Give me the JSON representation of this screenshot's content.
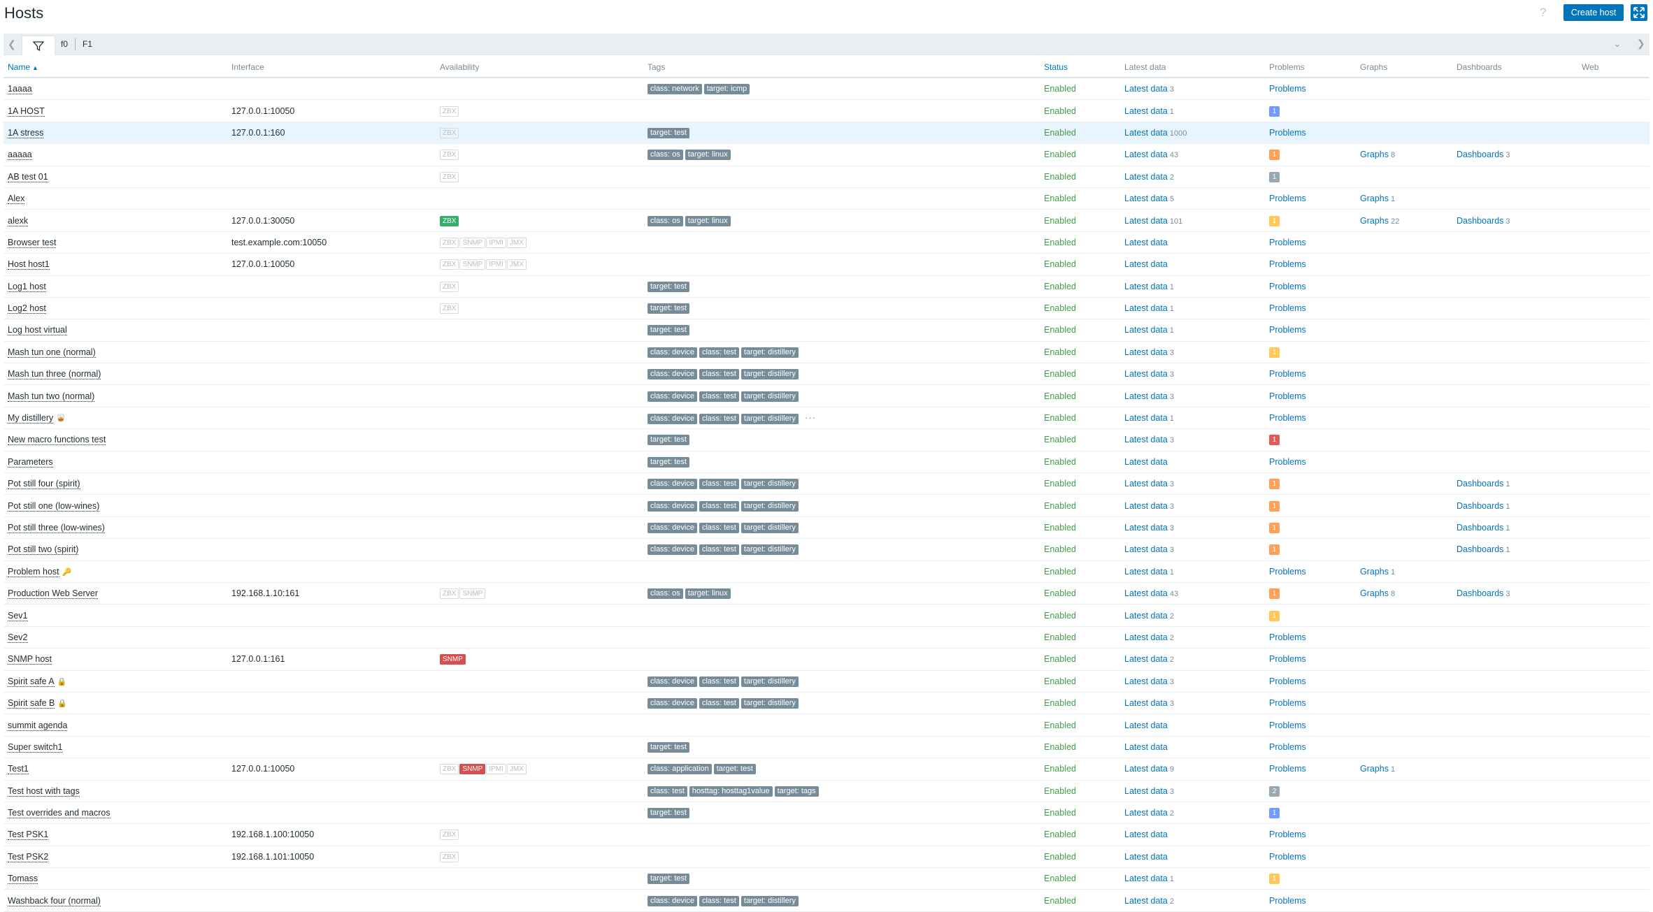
{
  "header": {
    "title": "Hosts",
    "help_glyph": "?",
    "create_label": "Create host",
    "fullscreen_icon": "fullscreen-icon"
  },
  "filter_tabs": [
    "f0",
    "F1"
  ],
  "columns": [
    "Name",
    "Interface",
    "Availability",
    "Tags",
    "Status",
    "Latest data",
    "Problems",
    "Graphs",
    "Dashboards",
    "Web"
  ],
  "colors": {
    "accent": "#0275b8",
    "enabled": "#429e47",
    "tag": "#768d99",
    "sev_info": "#7499ff",
    "sev_warning": "#ffa059",
    "sev_average": "#ffc859",
    "sev_high": "#e45959",
    "sev_unclassified": "#97aab3",
    "zbx_ok": "#34af67",
    "snmp_error": "#d64e4e"
  },
  "rows": [
    {
      "name": "1aaaa",
      "iface": "",
      "avail": [],
      "tags": [
        "class: network",
        "target: icmp"
      ],
      "status": "Enabled",
      "latest_label": "Latest data",
      "latest_count": "3",
      "problems": {
        "type": "link",
        "text": "Problems"
      },
      "graphs": "",
      "graphs_count": "",
      "dash": "",
      "dash_count": ""
    },
    {
      "name": "1A HOST",
      "iface": "127.0.0.1:10050",
      "avail": [
        {
          "t": "ZBX",
          "s": "na"
        }
      ],
      "tags": [],
      "status": "Enabled",
      "latest_label": "Latest data",
      "latest_count": "1",
      "problems": {
        "type": "sev",
        "text": "1",
        "sev": "sev_info"
      },
      "graphs": "",
      "graphs_count": "",
      "dash": "",
      "dash_count": ""
    },
    {
      "name": "1A stress",
      "iface": "127.0.0.1:160",
      "avail": [
        {
          "t": "ZBX",
          "s": "na"
        }
      ],
      "tags": [
        "target: test"
      ],
      "status": "Enabled",
      "latest_label": "Latest data",
      "latest_count": "1000",
      "problems": {
        "type": "link",
        "text": "Problems"
      },
      "graphs": "",
      "graphs_count": "",
      "dash": "",
      "dash_count": "",
      "highlight": true
    },
    {
      "name": "aaaaa",
      "iface": "",
      "avail": [
        {
          "t": "ZBX",
          "s": "na"
        }
      ],
      "tags": [
        "class: os",
        "target: linux"
      ],
      "status": "Enabled",
      "latest_label": "Latest data",
      "latest_count": "43",
      "problems": {
        "type": "sev",
        "text": "1",
        "sev": "sev_warning"
      },
      "graphs": "Graphs",
      "graphs_count": "8",
      "dash": "Dashboards",
      "dash_count": "3"
    },
    {
      "name": "AB test 01",
      "iface": "",
      "avail": [
        {
          "t": "ZBX",
          "s": "na"
        }
      ],
      "tags": [],
      "status": "Enabled",
      "latest_label": "Latest data",
      "latest_count": "2",
      "problems": {
        "type": "sev",
        "text": "1",
        "sev": "sev_unclassified"
      },
      "graphs": "",
      "graphs_count": "",
      "dash": "",
      "dash_count": ""
    },
    {
      "name": "Alex",
      "iface": "",
      "avail": [],
      "tags": [],
      "status": "Enabled",
      "latest_label": "Latest data",
      "latest_count": "5",
      "problems": {
        "type": "link",
        "text": "Problems"
      },
      "graphs": "Graphs",
      "graphs_count": "1",
      "dash": "",
      "dash_count": ""
    },
    {
      "name": "alexk",
      "iface": "127.0.0.1:30050",
      "avail": [
        {
          "t": "ZBX",
          "s": "ok"
        }
      ],
      "tags": [
        "class: os",
        "target: linux"
      ],
      "status": "Enabled",
      "latest_label": "Latest data",
      "latest_count": "101",
      "problems": {
        "type": "sev",
        "text": "1",
        "sev": "sev_average"
      },
      "graphs": "Graphs",
      "graphs_count": "22",
      "dash": "Dashboards",
      "dash_count": "3"
    },
    {
      "name": "Browser test",
      "iface": "test.example.com:10050",
      "avail": [
        {
          "t": "ZBX",
          "s": "na"
        },
        {
          "t": "SNMP",
          "s": "na"
        },
        {
          "t": "IPMI",
          "s": "na"
        },
        {
          "t": "JMX",
          "s": "na"
        }
      ],
      "tags": [],
      "status": "Enabled",
      "latest_label": "Latest data",
      "latest_count": "",
      "problems": {
        "type": "link",
        "text": "Problems"
      },
      "graphs": "",
      "graphs_count": "",
      "dash": "",
      "dash_count": ""
    },
    {
      "name": "Host host1",
      "iface": "127.0.0.1:10050",
      "avail": [
        {
          "t": "ZBX",
          "s": "na"
        },
        {
          "t": "SNMP",
          "s": "na"
        },
        {
          "t": "IPMI",
          "s": "na"
        },
        {
          "t": "JMX",
          "s": "na"
        }
      ],
      "tags": [],
      "status": "Enabled",
      "latest_label": "Latest data",
      "latest_count": "",
      "problems": {
        "type": "link",
        "text": "Problems"
      },
      "graphs": "",
      "graphs_count": "",
      "dash": "",
      "dash_count": ""
    },
    {
      "name": "Log1 host",
      "iface": "",
      "avail": [
        {
          "t": "ZBX",
          "s": "na"
        }
      ],
      "tags": [
        "target: test"
      ],
      "status": "Enabled",
      "latest_label": "Latest data",
      "latest_count": "1",
      "problems": {
        "type": "link",
        "text": "Problems"
      },
      "graphs": "",
      "graphs_count": "",
      "dash": "",
      "dash_count": ""
    },
    {
      "name": "Log2 host",
      "iface": "",
      "avail": [
        {
          "t": "ZBX",
          "s": "na"
        }
      ],
      "tags": [
        "target: test"
      ],
      "status": "Enabled",
      "latest_label": "Latest data",
      "latest_count": "1",
      "problems": {
        "type": "link",
        "text": "Problems"
      },
      "graphs": "",
      "graphs_count": "",
      "dash": "",
      "dash_count": ""
    },
    {
      "name": "Log host virtual",
      "iface": "",
      "avail": [],
      "tags": [
        "target: test"
      ],
      "status": "Enabled",
      "latest_label": "Latest data",
      "latest_count": "1",
      "problems": {
        "type": "link",
        "text": "Problems"
      },
      "graphs": "",
      "graphs_count": "",
      "dash": "",
      "dash_count": ""
    },
    {
      "name": "Mash tun one (normal)",
      "iface": "",
      "avail": [],
      "tags": [
        "class: device",
        "class: test",
        "target: distillery"
      ],
      "status": "Enabled",
      "latest_label": "Latest data",
      "latest_count": "3",
      "problems": {
        "type": "sev",
        "text": "1",
        "sev": "sev_average"
      },
      "graphs": "",
      "graphs_count": "",
      "dash": "",
      "dash_count": ""
    },
    {
      "name": "Mash tun three (normal)",
      "iface": "",
      "avail": [],
      "tags": [
        "class: device",
        "class: test",
        "target: distillery"
      ],
      "status": "Enabled",
      "latest_label": "Latest data",
      "latest_count": "3",
      "problems": {
        "type": "link",
        "text": "Problems"
      },
      "graphs": "",
      "graphs_count": "",
      "dash": "",
      "dash_count": ""
    },
    {
      "name": "Mash tun two (normal)",
      "iface": "",
      "avail": [],
      "tags": [
        "class: device",
        "class: test",
        "target: distillery"
      ],
      "status": "Enabled",
      "latest_label": "Latest data",
      "latest_count": "3",
      "problems": {
        "type": "link",
        "text": "Problems"
      },
      "graphs": "",
      "graphs_count": "",
      "dash": "",
      "dash_count": ""
    },
    {
      "name": "My distillery",
      "marker": "🥃",
      "iface": "",
      "avail": [],
      "tags": [
        "class: device",
        "class: test",
        "target: distillery"
      ],
      "more": "···",
      "status": "Enabled",
      "latest_label": "Latest data",
      "latest_count": "1",
      "problems": {
        "type": "link",
        "text": "Problems"
      },
      "graphs": "",
      "graphs_count": "",
      "dash": "",
      "dash_count": ""
    },
    {
      "name": "New macro functions test",
      "iface": "",
      "avail": [],
      "tags": [
        "target: test"
      ],
      "status": "Enabled",
      "latest_label": "Latest data",
      "latest_count": "3",
      "problems": {
        "type": "sev",
        "text": "1",
        "sev": "sev_high"
      },
      "graphs": "",
      "graphs_count": "",
      "dash": "",
      "dash_count": ""
    },
    {
      "name": "Parameters",
      "iface": "",
      "avail": [],
      "tags": [
        "target: test"
      ],
      "status": "Enabled",
      "latest_label": "Latest data",
      "latest_count": "",
      "problems": {
        "type": "link",
        "text": "Problems"
      },
      "graphs": "",
      "graphs_count": "",
      "dash": "",
      "dash_count": ""
    },
    {
      "name": "Pot still four (spirit)",
      "iface": "",
      "avail": [],
      "tags": [
        "class: device",
        "class: test",
        "target: distillery"
      ],
      "status": "Enabled",
      "latest_label": "Latest data",
      "latest_count": "3",
      "problems": {
        "type": "sev",
        "text": "1",
        "sev": "sev_warning"
      },
      "graphs": "",
      "graphs_count": "",
      "dash": "Dashboards",
      "dash_count": "1"
    },
    {
      "name": "Pot still one (low-wines)",
      "iface": "",
      "avail": [],
      "tags": [
        "class: device",
        "class: test",
        "target: distillery"
      ],
      "status": "Enabled",
      "latest_label": "Latest data",
      "latest_count": "3",
      "problems": {
        "type": "sev",
        "text": "1",
        "sev": "sev_warning"
      },
      "graphs": "",
      "graphs_count": "",
      "dash": "Dashboards",
      "dash_count": "1"
    },
    {
      "name": "Pot still three (low-wines)",
      "iface": "",
      "avail": [],
      "tags": [
        "class: device",
        "class: test",
        "target: distillery"
      ],
      "status": "Enabled",
      "latest_label": "Latest data",
      "latest_count": "3",
      "problems": {
        "type": "sev",
        "text": "1",
        "sev": "sev_warning"
      },
      "graphs": "",
      "graphs_count": "",
      "dash": "Dashboards",
      "dash_count": "1"
    },
    {
      "name": "Pot still two (spirit)",
      "iface": "",
      "avail": [],
      "tags": [
        "class: device",
        "class: test",
        "target: distillery"
      ],
      "status": "Enabled",
      "latest_label": "Latest data",
      "latest_count": "3",
      "problems": {
        "type": "sev",
        "text": "1",
        "sev": "sev_warning"
      },
      "graphs": "",
      "graphs_count": "",
      "dash": "Dashboards",
      "dash_count": "1"
    },
    {
      "name": "Problem host",
      "marker": "🔑",
      "iface": "",
      "avail": [],
      "tags": [],
      "status": "Enabled",
      "latest_label": "Latest data",
      "latest_count": "1",
      "problems": {
        "type": "link",
        "text": "Problems"
      },
      "graphs": "Graphs",
      "graphs_count": "1",
      "dash": "",
      "dash_count": ""
    },
    {
      "name": "Production Web Server",
      "iface": "192.168.1.10:161",
      "avail": [
        {
          "t": "ZBX",
          "s": "na"
        },
        {
          "t": "SNMP",
          "s": "na"
        }
      ],
      "tags": [
        "class: os",
        "target: linux"
      ],
      "status": "Enabled",
      "latest_label": "Latest data",
      "latest_count": "43",
      "problems": {
        "type": "sev",
        "text": "1",
        "sev": "sev_warning"
      },
      "graphs": "Graphs",
      "graphs_count": "8",
      "dash": "Dashboards",
      "dash_count": "3"
    },
    {
      "name": "Sev1",
      "iface": "",
      "avail": [],
      "tags": [],
      "status": "Enabled",
      "latest_label": "Latest data",
      "latest_count": "2",
      "problems": {
        "type": "sev",
        "text": "1",
        "sev": "sev_average"
      },
      "graphs": "",
      "graphs_count": "",
      "dash": "",
      "dash_count": ""
    },
    {
      "name": "Sev2",
      "iface": "",
      "avail": [],
      "tags": [],
      "status": "Enabled",
      "latest_label": "Latest data",
      "latest_count": "2",
      "problems": {
        "type": "link",
        "text": "Problems"
      },
      "graphs": "",
      "graphs_count": "",
      "dash": "",
      "dash_count": ""
    },
    {
      "name": "SNMP host",
      "iface": "127.0.0.1:161",
      "avail": [
        {
          "t": "SNMP",
          "s": "bad"
        }
      ],
      "tags": [],
      "status": "Enabled",
      "latest_label": "Latest data",
      "latest_count": "2",
      "problems": {
        "type": "link",
        "text": "Problems"
      },
      "graphs": "",
      "graphs_count": "",
      "dash": "",
      "dash_count": ""
    },
    {
      "name": "Spirit safe A",
      "marker": "🔒",
      "iface": "",
      "avail": [],
      "tags": [
        "class: device",
        "class: test",
        "target: distillery"
      ],
      "status": "Enabled",
      "latest_label": "Latest data",
      "latest_count": "3",
      "problems": {
        "type": "link",
        "text": "Problems"
      },
      "graphs": "",
      "graphs_count": "",
      "dash": "",
      "dash_count": ""
    },
    {
      "name": "Spirit safe B",
      "marker": "🔒",
      "iface": "",
      "avail": [],
      "tags": [
        "class: device",
        "class: test",
        "target: distillery"
      ],
      "status": "Enabled",
      "latest_label": "Latest data",
      "latest_count": "3",
      "problems": {
        "type": "link",
        "text": "Problems"
      },
      "graphs": "",
      "graphs_count": "",
      "dash": "",
      "dash_count": ""
    },
    {
      "name": "summit agenda",
      "iface": "",
      "avail": [],
      "tags": [],
      "status": "Enabled",
      "latest_label": "Latest data",
      "latest_count": "",
      "problems": {
        "type": "link",
        "text": "Problems"
      },
      "graphs": "",
      "graphs_count": "",
      "dash": "",
      "dash_count": ""
    },
    {
      "name": "Super switch1",
      "iface": "",
      "avail": [],
      "tags": [
        "target: test"
      ],
      "status": "Enabled",
      "latest_label": "Latest data",
      "latest_count": "",
      "problems": {
        "type": "link",
        "text": "Problems"
      },
      "graphs": "",
      "graphs_count": "",
      "dash": "",
      "dash_count": ""
    },
    {
      "name": "Test1",
      "iface": "127.0.0.1:10050",
      "avail": [
        {
          "t": "ZBX",
          "s": "na"
        },
        {
          "t": "SNMP",
          "s": "bad"
        },
        {
          "t": "IPMI",
          "s": "na"
        },
        {
          "t": "JMX",
          "s": "na"
        }
      ],
      "tags": [
        "class: application",
        "target: test"
      ],
      "status": "Enabled",
      "latest_label": "Latest data",
      "latest_count": "9",
      "problems": {
        "type": "link",
        "text": "Problems"
      },
      "graphs": "Graphs",
      "graphs_count": "1",
      "dash": "",
      "dash_count": ""
    },
    {
      "name": "Test host with tags",
      "iface": "",
      "avail": [],
      "tags": [
        "class: test",
        "hosttag: hosttag1value",
        "target: tags"
      ],
      "status": "Enabled",
      "latest_label": "Latest data",
      "latest_count": "3",
      "problems": {
        "type": "sev",
        "text": "2",
        "sev": "sev_unclassified"
      },
      "graphs": "",
      "graphs_count": "",
      "dash": "",
      "dash_count": ""
    },
    {
      "name": "Test overrides and macros",
      "iface": "",
      "avail": [],
      "tags": [
        "target: test"
      ],
      "status": "Enabled",
      "latest_label": "Latest data",
      "latest_count": "2",
      "problems": {
        "type": "sev",
        "text": "1",
        "sev": "sev_info"
      },
      "graphs": "",
      "graphs_count": "",
      "dash": "",
      "dash_count": ""
    },
    {
      "name": "Test PSK1",
      "iface": "192.168.1.100:10050",
      "avail": [
        {
          "t": "ZBX",
          "s": "na"
        }
      ],
      "tags": [],
      "status": "Enabled",
      "latest_label": "Latest data",
      "latest_count": "",
      "problems": {
        "type": "link",
        "text": "Problems"
      },
      "graphs": "",
      "graphs_count": "",
      "dash": "",
      "dash_count": ""
    },
    {
      "name": "Test PSK2",
      "iface": "192.168.1.101:10050",
      "avail": [
        {
          "t": "ZBX",
          "s": "na"
        }
      ],
      "tags": [],
      "status": "Enabled",
      "latest_label": "Latest data",
      "latest_count": "",
      "problems": {
        "type": "link",
        "text": "Problems"
      },
      "graphs": "",
      "graphs_count": "",
      "dash": "",
      "dash_count": ""
    },
    {
      "name": "Tomass",
      "iface": "",
      "avail": [],
      "tags": [
        "target: test"
      ],
      "status": "Enabled",
      "latest_label": "Latest data",
      "latest_count": "1",
      "problems": {
        "type": "sev",
        "text": "1",
        "sev": "sev_average"
      },
      "graphs": "",
      "graphs_count": "",
      "dash": "",
      "dash_count": ""
    },
    {
      "name": "Washback four (normal)",
      "iface": "",
      "avail": [],
      "tags": [
        "class: device",
        "class: test",
        "target: distillery"
      ],
      "status": "Enabled",
      "latest_label": "Latest data",
      "latest_count": "2",
      "problems": {
        "type": "link",
        "text": "Problems"
      },
      "graphs": "",
      "graphs_count": "",
      "dash": "",
      "dash_count": ""
    }
  ]
}
